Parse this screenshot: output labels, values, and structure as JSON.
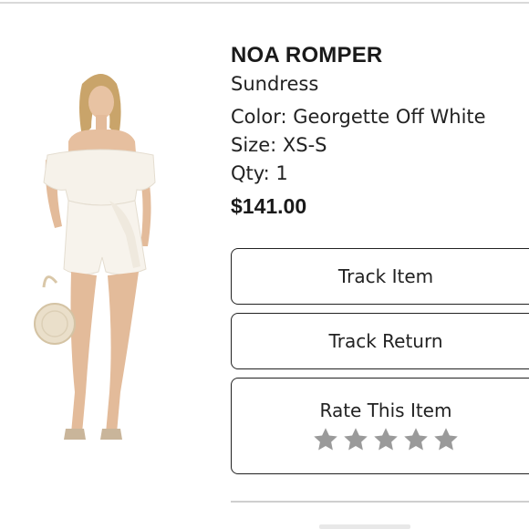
{
  "product": {
    "name": "NOA ROMPER",
    "category": "Sundress",
    "color_line": "Color: Georgette Off White",
    "size_line": "Size: XS-S",
    "qty_line": "Qty: 1",
    "price": "$141.00"
  },
  "actions": {
    "track_item": "Track Item",
    "track_return": "Track Return",
    "rate_label": "Rate This Item",
    "rating": {
      "value": 0,
      "max": 5
    }
  },
  "icons": {
    "star": "star-icon",
    "photo": "product-photo"
  },
  "colors": {
    "text": "#1a1a1a",
    "star_empty": "#9a9a9a",
    "border": "#222222",
    "divider": "#d9d9d9"
  }
}
